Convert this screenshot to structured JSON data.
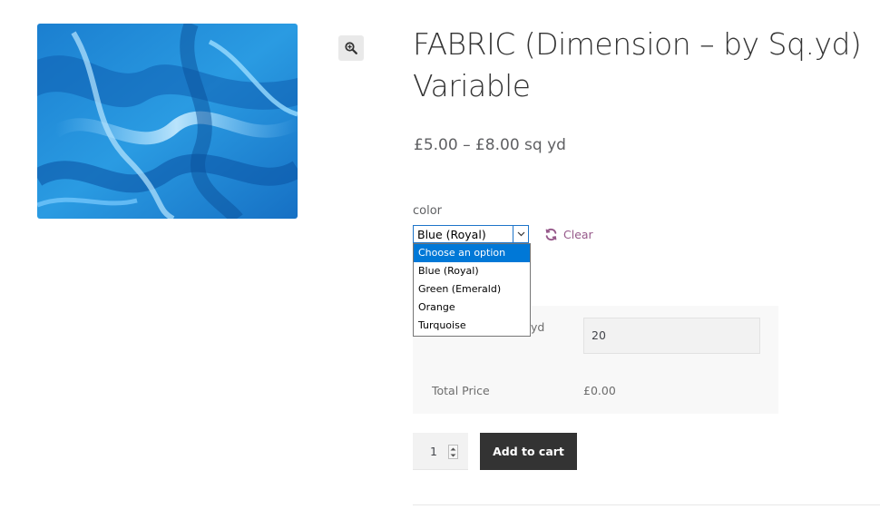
{
  "product": {
    "title": "FABRIC (Dimension – by Sq.yd) Variable",
    "price": "£5.00 – £8.00 sq yd",
    "image_icon": "fabric-photo",
    "zoom_icon": "magnifier-plus-icon"
  },
  "variation": {
    "label": "color",
    "selected": "Blue (Royal)",
    "clear_label": "Clear",
    "options": [
      "Choose an option",
      "Blue (Royal)",
      "Green (Emerald)",
      "Orange",
      "Turquoise"
    ],
    "highlighted_option": "Choose an option"
  },
  "measurement": {
    "label_fragment": "yd",
    "value": "20",
    "total_label": "Total Price",
    "total_value": "£0.00"
  },
  "cart": {
    "quantity": "1",
    "add_to_cart_label": "Add to cart"
  },
  "colors": {
    "accent": "#96588a",
    "button": "#333333",
    "fabric": "#1e8fd8",
    "select_highlight": "#0078d7"
  }
}
